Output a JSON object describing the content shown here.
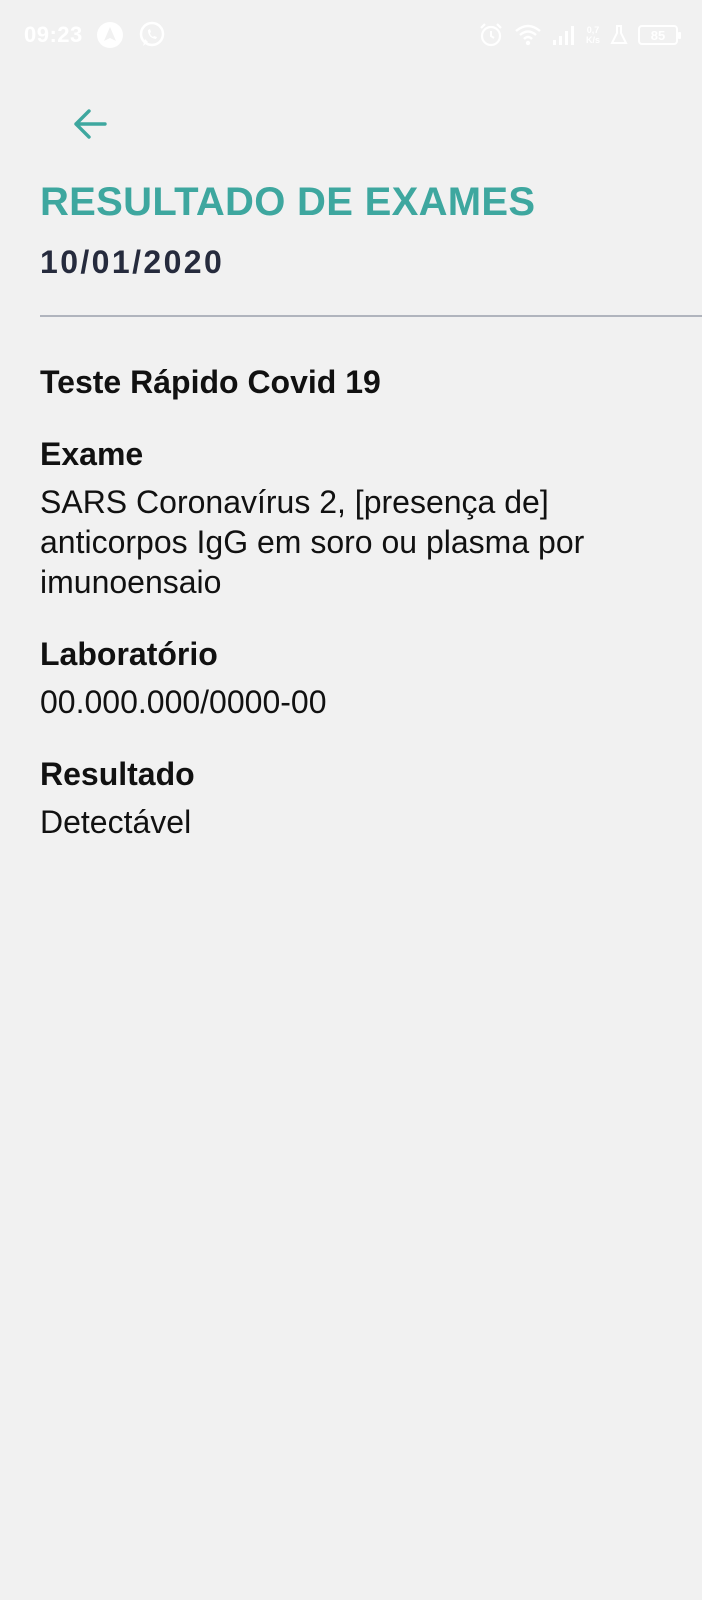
{
  "status_bar": {
    "time": "09:23",
    "battery": "85",
    "net_speed_top": "0,7",
    "net_speed_bottom": "K/s",
    "icons": [
      "navigation-app-icon",
      "whatsapp-icon",
      "alarm-icon",
      "wifi-icon",
      "signal-icon",
      "flask-icon",
      "battery-icon"
    ]
  },
  "header": {
    "back_icon": "arrow-left-icon",
    "title": "RESULTADO DE EXAMES",
    "date": "10/01/2020"
  },
  "result": {
    "test_name": "Teste Rápido Covid 19",
    "exam_label": "Exame",
    "exam_value": "SARS Coronavírus 2, [presença de] anticorpos IgG em soro ou plasma por imunoensaio",
    "lab_label": "Laboratório",
    "lab_value": "00.000.000/0000-00",
    "result_label": "Resultado",
    "result_value": "Detectável"
  },
  "colors": {
    "accent": "#3ea79f",
    "background": "#f1f1f1",
    "date_text": "#262b3d",
    "divider": "#b0b4bd"
  }
}
